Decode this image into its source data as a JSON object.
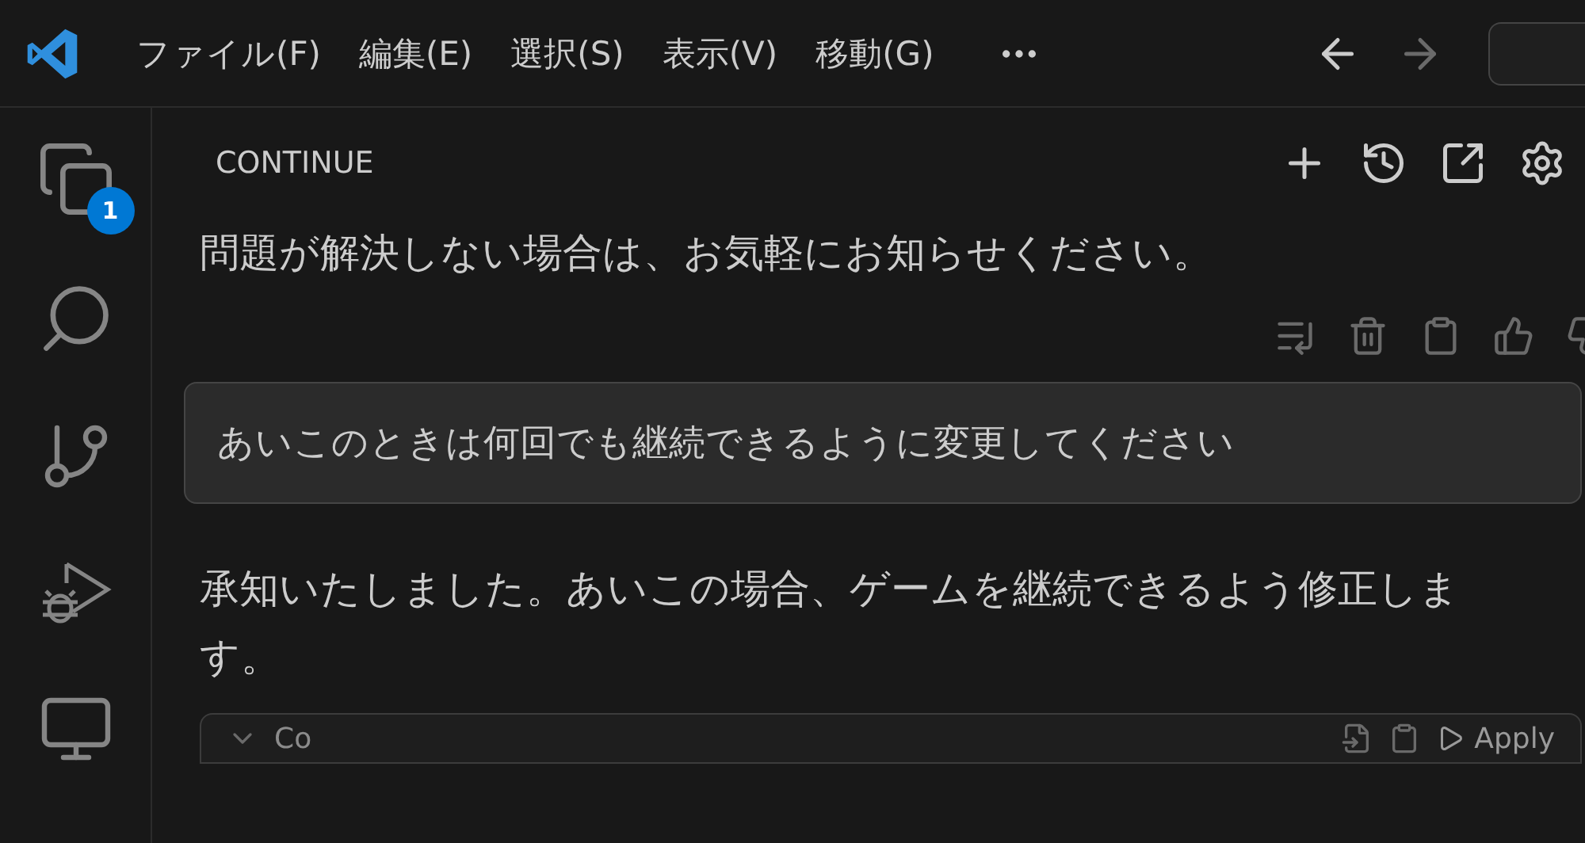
{
  "menu": [
    "ファイル(F)",
    "編集(E)",
    "選択(S)",
    "表示(V)",
    "移動(G)"
  ],
  "nav": {
    "back_disabled": false,
    "forward_disabled": true
  },
  "activity_bar": {
    "badge": "1"
  },
  "panel": {
    "title": "CONTINUE"
  },
  "messages": [
    {
      "kind": "assistant",
      "text": "問題が解決しない場合は、お気軽にお知らせください。",
      "show_actions": true
    },
    {
      "kind": "user",
      "text": "あいこのときは何回でも継続できるように変更してください"
    },
    {
      "kind": "assistant",
      "text": "承知いたしました。あいこの場合、ゲームを継続できるよう修正します。",
      "show_actions": false
    }
  ],
  "code_block": {
    "label": "Co",
    "apply": "Apply"
  }
}
